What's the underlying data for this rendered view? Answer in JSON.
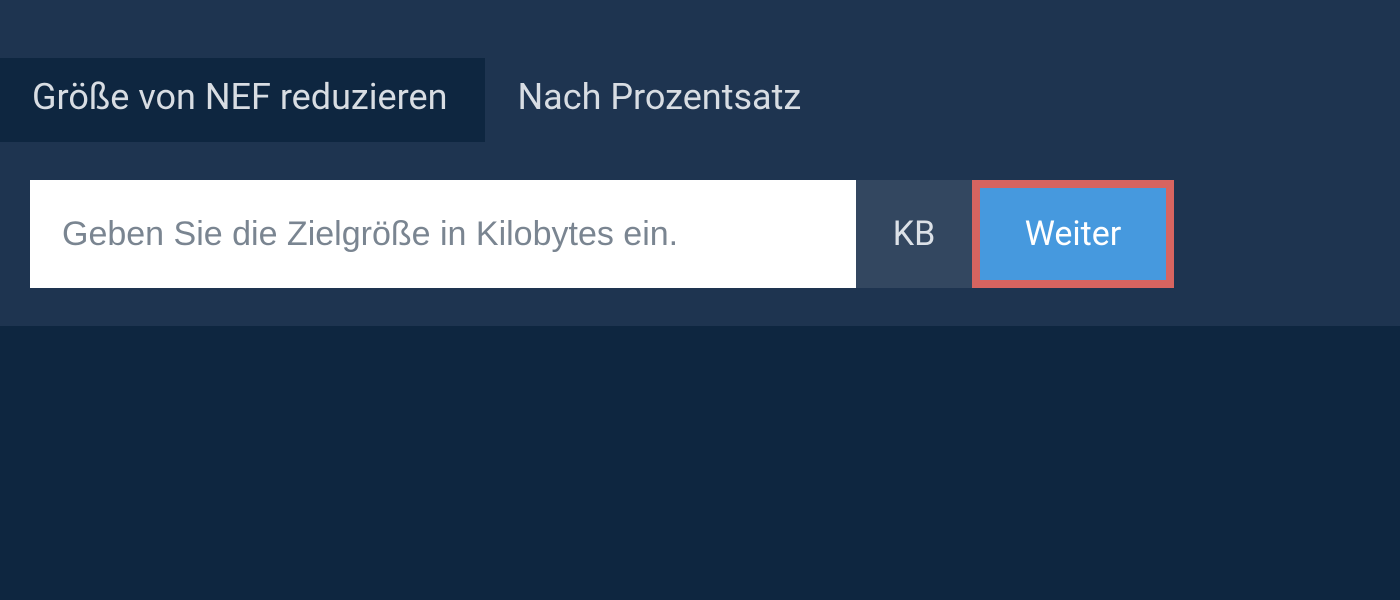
{
  "tabs": {
    "reduce_size": "Größe von NEF reduzieren",
    "by_percentage": "Nach Prozentsatz"
  },
  "input": {
    "placeholder": "Geben Sie die Zielgröße in Kilobytes ein.",
    "value": ""
  },
  "unit": "KB",
  "button": {
    "continue": "Weiter"
  }
}
